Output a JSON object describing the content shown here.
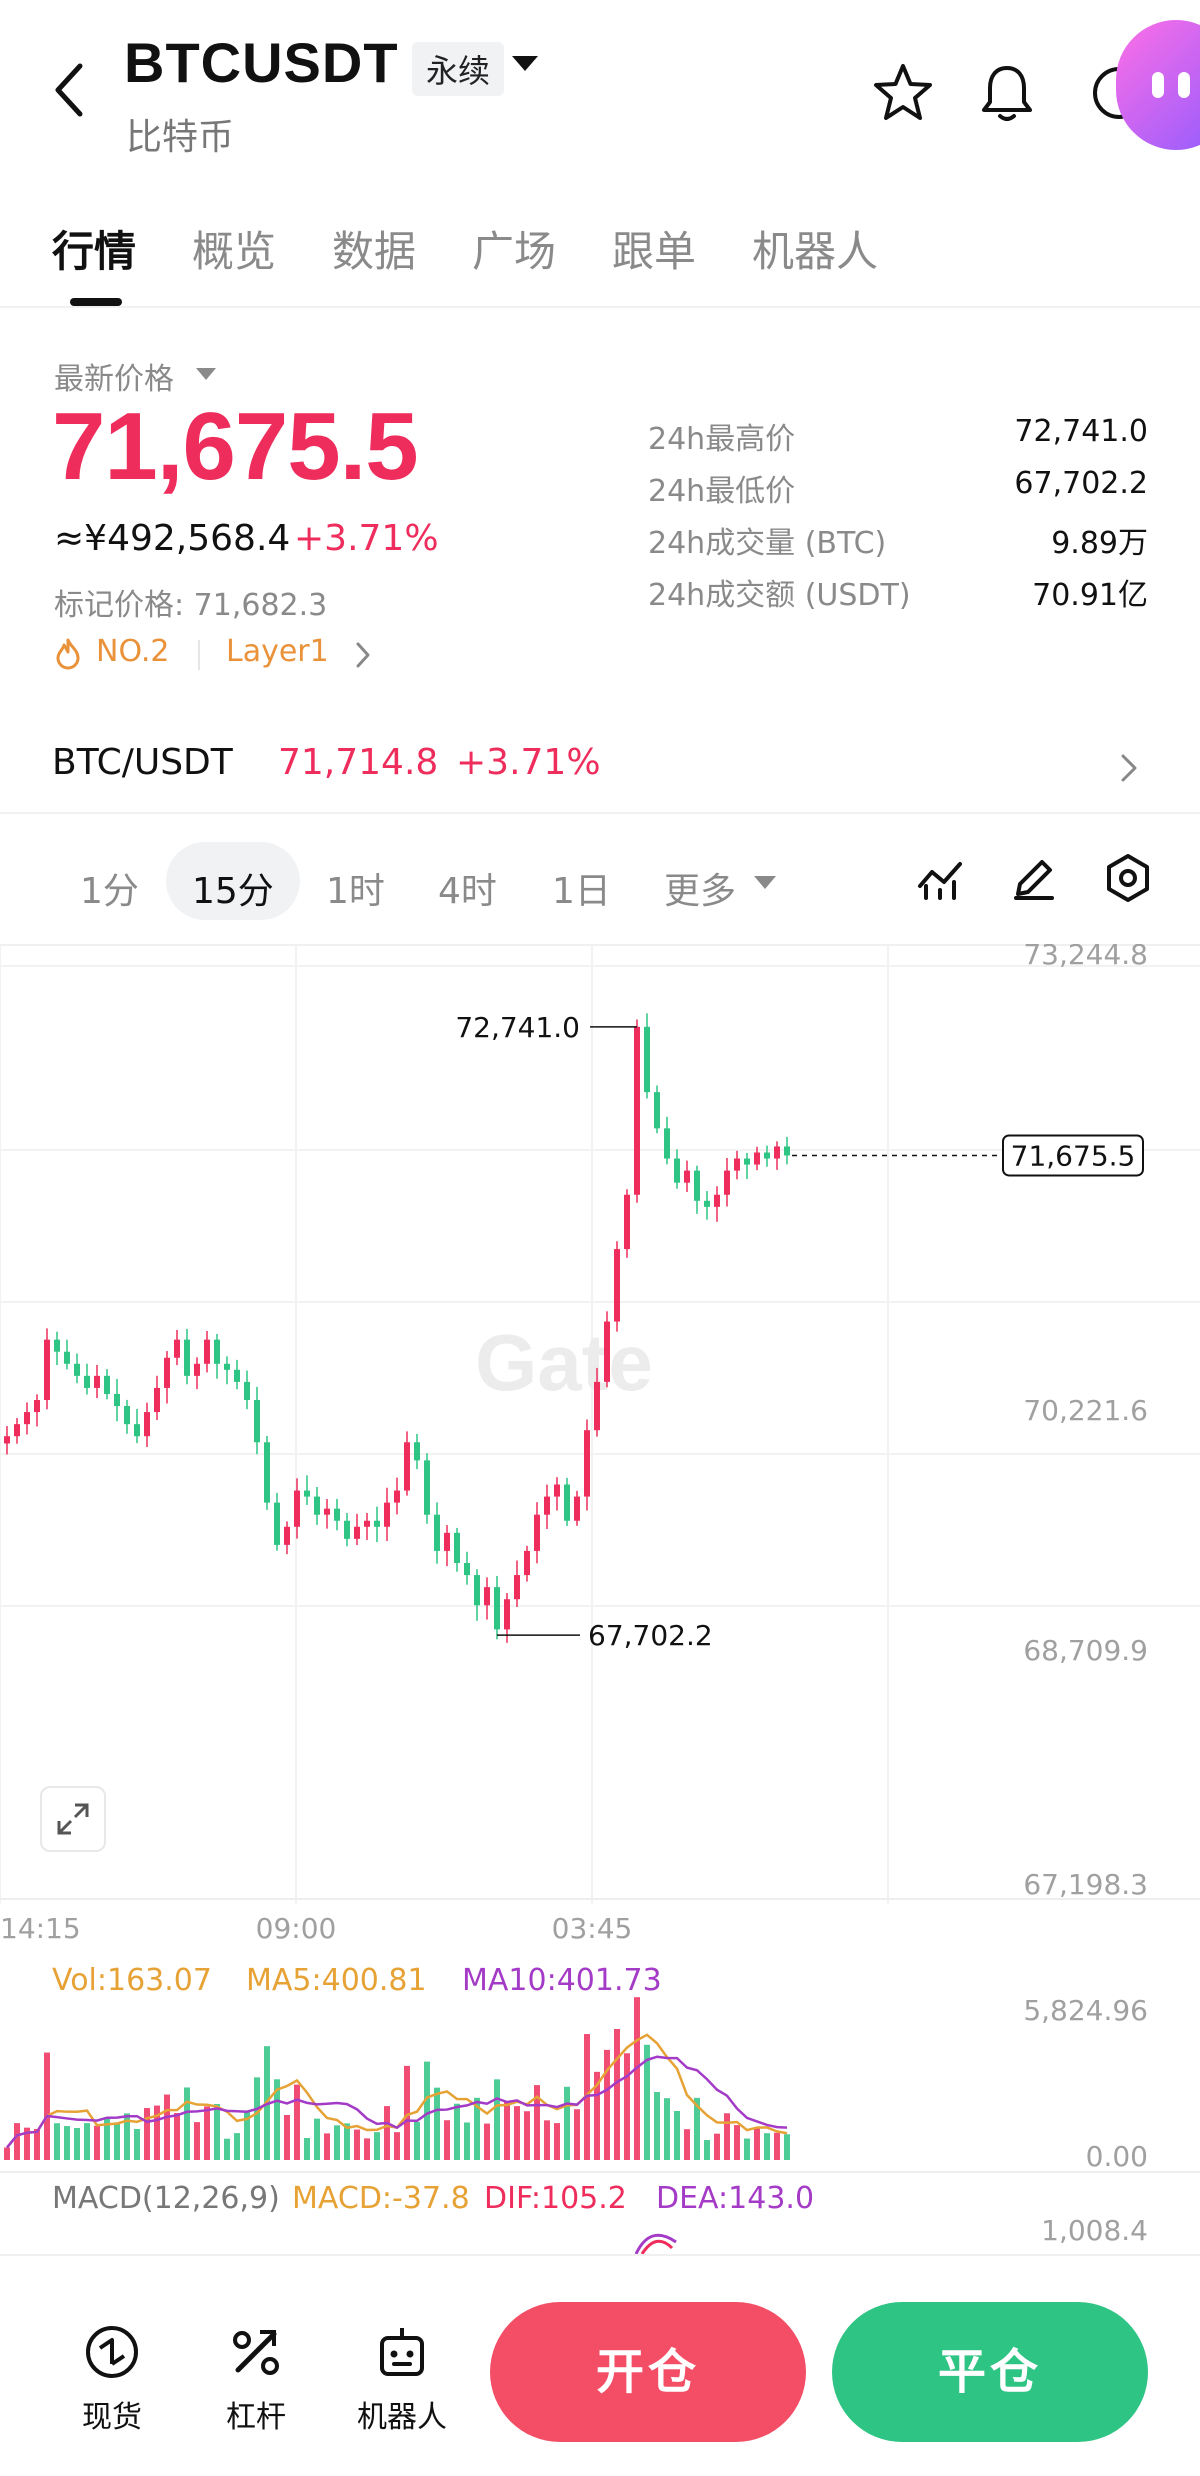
{
  "header": {
    "symbol": "BTCUSDT",
    "contract_type": "永续",
    "name_cn": "比特币"
  },
  "tabs": [
    "行情",
    "概览",
    "数据",
    "广场",
    "跟单",
    "机器人"
  ],
  "price": {
    "latest_label": "最新价格",
    "last": "71,675.5",
    "cny": "≈¥492,568.4",
    "change_pct": "+3.71%",
    "mark_label": "标记价格: 71,682.3",
    "rank_tag": "NO.2",
    "category_tag": "Layer1"
  },
  "stats": [
    {
      "label": "24h最高价",
      "value": "72,741.0"
    },
    {
      "label": "24h最低价",
      "value": "67,702.2"
    },
    {
      "label": "24h成交量 (BTC)",
      "value": "9.89万"
    },
    {
      "label": "24h成交额 (USDT)",
      "value": "70.91亿"
    }
  ],
  "spot_pair": {
    "name": "BTC/USDT",
    "price": "71,714.8",
    "change": "+3.71%"
  },
  "timeframes": [
    "1分",
    "15分",
    "1时",
    "4时",
    "1日",
    "更多"
  ],
  "selected_timeframe": "15分",
  "chart": {
    "y_ticks": [
      "73,244.8",
      "70,221.6",
      "68,709.9",
      "67,198.3"
    ],
    "x_ticks": [
      "14:15",
      "09:00",
      "03:45"
    ],
    "current_price_tag": "71,675.5",
    "high_label": "72,741.0",
    "low_label": "67,702.2",
    "watermark": "Gate",
    "volume": {
      "vol": "Vol:163.07",
      "ma5": "MA5:400.81",
      "ma10": "MA10:401.73",
      "max_tick": "5,824.96",
      "min_tick": "0.00"
    },
    "macd": {
      "title": "MACD(12,26,9)",
      "macd": "MACD:-37.8",
      "dif": "DIF:105.2",
      "dea": "DEA:143.0",
      "top_tick": "1,008.4"
    }
  },
  "chart_data": {
    "type": "line",
    "y_range": [
      67198.3,
      73244.8
    ],
    "x_labels": [
      "14:15",
      "09:00",
      "03:45"
    ],
    "close_path": [
      69350,
      69450,
      69550,
      69650,
      70150,
      70050,
      69950,
      69850,
      69750,
      69850,
      69700,
      69600,
      69450,
      69350,
      69550,
      69750,
      70000,
      70150,
      69850,
      69950,
      70150,
      69950,
      69900,
      69800,
      69650,
      69300,
      68800,
      68450,
      68600,
      68900,
      68850,
      68700,
      68750,
      68650,
      68500,
      68600,
      68650,
      68600,
      68800,
      68900,
      69300,
      69150,
      68700,
      68400,
      68550,
      68300,
      68200,
      67950,
      68100,
      67750,
      68000,
      68200,
      68400,
      68700,
      68850,
      68950,
      68650,
      68850,
      69400,
      69800,
      70300,
      70900,
      71350,
      72741,
      72200,
      71900,
      71650,
      71450,
      71550,
      71300,
      71250,
      71350,
      71550,
      71650,
      71600,
      71700,
      71650,
      71750,
      71675.5
    ],
    "high": 72741.0,
    "low": 67702.2,
    "last": 71675.5
  },
  "bottom_nav": [
    {
      "label": "现货",
      "icon": "spot-icon"
    },
    {
      "label": "杠杆",
      "icon": "leverage-icon"
    },
    {
      "label": "机器人",
      "icon": "robot-icon"
    }
  ],
  "actions": {
    "open": "开仓",
    "close": "平仓"
  },
  "colors": {
    "up": "#ee2d5c",
    "down": "#2ec483",
    "accent_orange": "#e9923a",
    "ma5": "#e7a236",
    "ma10": "#a43bc7"
  }
}
